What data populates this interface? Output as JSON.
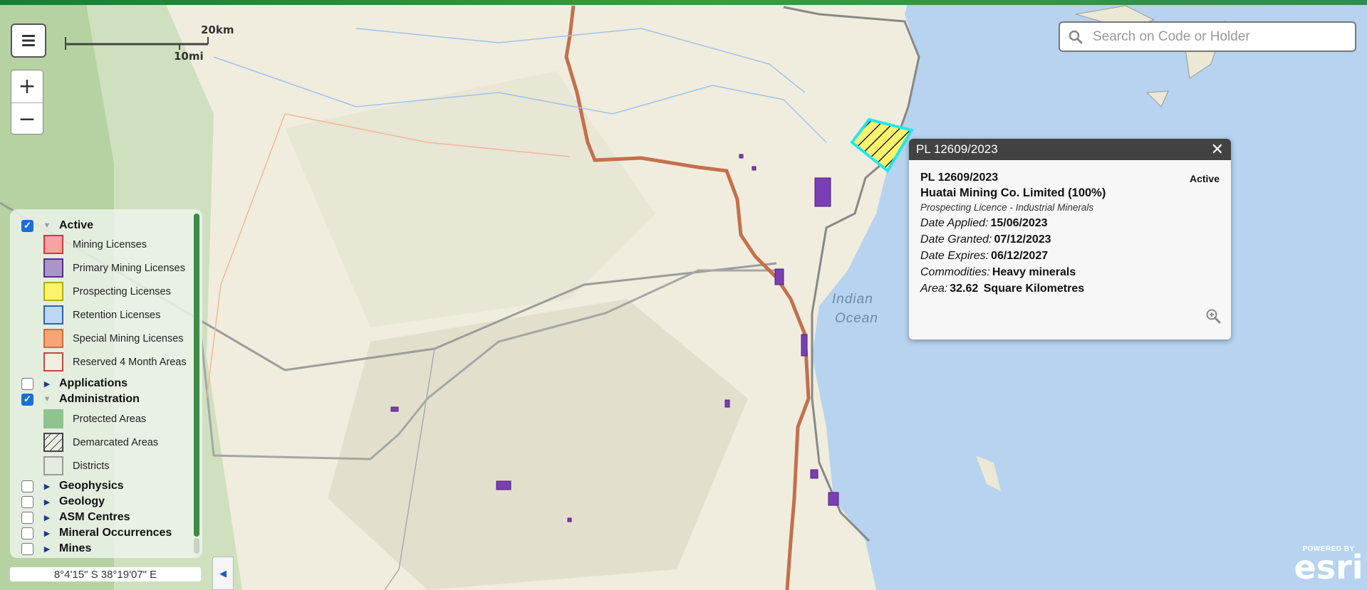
{
  "map": {
    "scale": {
      "km_label": "20km",
      "mi_label": "10mi"
    },
    "ocean_label_line1": "Indian",
    "ocean_label_line2": "Ocean",
    "attribution_top": "POWERED BY",
    "attribution_brand": "esri"
  },
  "controls": {
    "zoom_in": "+",
    "zoom_out": "−",
    "menu_icon": "hamburger-icon"
  },
  "search": {
    "placeholder": "Search on Code or Holder",
    "value": ""
  },
  "legend": {
    "groups": [
      {
        "label": "Active",
        "checked": true,
        "expanded": true,
        "items": [
          {
            "label": "Mining Licenses",
            "fill": "#f6a3a3",
            "stroke": "#d33"
          },
          {
            "label": "Primary Mining Licenses",
            "fill": "#a995c9",
            "stroke": "#5a2b8a"
          },
          {
            "label": "Prospecting Licenses",
            "fill": "#fbf36b",
            "stroke": "#b9ad00"
          },
          {
            "label": "Retention Licenses",
            "fill": "#bcd7f3",
            "stroke": "#2a62b8"
          },
          {
            "label": "Special Mining Licenses",
            "fill": "#f8a47a",
            "stroke": "#d96a2a"
          },
          {
            "label": "Reserved 4 Month Areas",
            "fill": "#f3efe0",
            "stroke": "#c44"
          }
        ]
      },
      {
        "label": "Applications",
        "checked": false,
        "expanded": false
      },
      {
        "label": "Administration",
        "checked": true,
        "expanded": true,
        "items": [
          {
            "label": "Protected Areas",
            "fill": "#8fc48e",
            "stroke": "#8fc48e"
          },
          {
            "label": "Demarcated Areas",
            "fill": "hatch",
            "stroke": "#444"
          },
          {
            "label": "Districts",
            "fill": "#e4ece0",
            "stroke": "#999"
          }
        ]
      },
      {
        "label": "Geophysics",
        "checked": false,
        "expanded": false
      },
      {
        "label": "Geology",
        "checked": false,
        "expanded": false
      },
      {
        "label": "ASM Centres",
        "checked": false,
        "expanded": false
      },
      {
        "label": "Mineral Occurrences",
        "checked": false,
        "expanded": false
      },
      {
        "label": "Mines",
        "checked": false,
        "expanded": false
      }
    ]
  },
  "coordinates": "8°4'15\" S  38°19'07\" E",
  "popup": {
    "title": "PL 12609/2023",
    "code": "PL 12609/2023",
    "status": "Active",
    "holder": "Huatai Mining Co. Limited (100%)",
    "type": "Prospecting Licence - Industrial Minerals",
    "fields": [
      {
        "key": "Date Applied:",
        "value": "15/06/2023"
      },
      {
        "key": "Date Granted:",
        "value": "07/12/2023"
      },
      {
        "key": "Date Expires:",
        "value": "06/12/2027"
      },
      {
        "key": "Commodities:",
        "value": "Heavy minerals"
      },
      {
        "key": "Area:",
        "value": "32.62",
        "unit": "Square Kilometres"
      }
    ]
  },
  "colors": {
    "land": "#f2efe3",
    "ocean": "#b7d3ef",
    "road": "#c77a55",
    "prospecting_highlight": "#22e6f0",
    "primary_mining": "#6a2ea0"
  }
}
